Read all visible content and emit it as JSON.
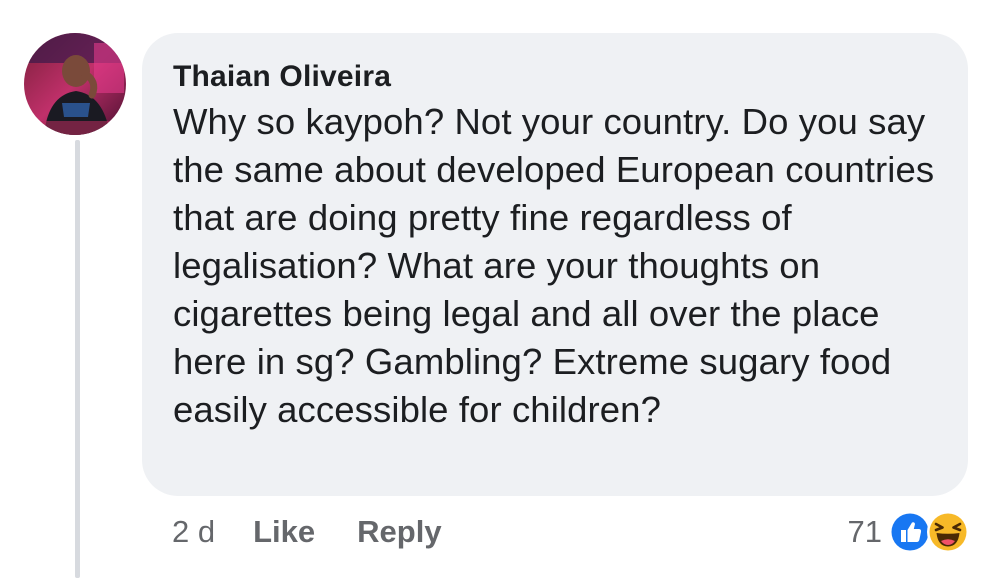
{
  "comment": {
    "author": "Thaian Oliveira",
    "text": "Why so kaypoh? Not your country. Do you say the same about developed European countries that are doing pretty fine regardless of legalisation? What are your thoughts on cigarettes being legal and all over the place here in sg? Gambling? Extreme sugary food easily accessible for children?",
    "timestamp": "2 d",
    "like_label": "Like",
    "reply_label": "Reply",
    "reaction_count": "71",
    "reactions": [
      "like-reaction-icon",
      "haha-reaction-icon"
    ]
  },
  "colors": {
    "bubble": "#eff1f4",
    "text": "#1c1e21",
    "secondary": "#65676b",
    "like_blue": "#1877f2",
    "haha_yellow": "#f7b928"
  }
}
